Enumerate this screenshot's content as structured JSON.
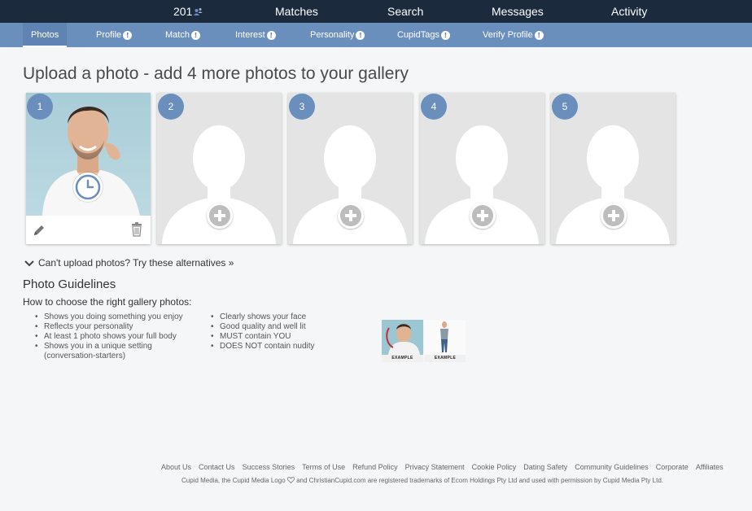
{
  "top_nav": {
    "count": "201",
    "items": [
      "Matches",
      "Search",
      "Messages",
      "Activity"
    ]
  },
  "sub_nav": {
    "tabs": [
      "Photos",
      "Profile",
      "Match",
      "Interest",
      "Personality",
      "CupidTags",
      "Verify Profile"
    ],
    "active": "Photos"
  },
  "main": {
    "title": "Upload a photo - add 4 more photos to your gallery",
    "tiles": [
      {
        "number": "1",
        "state": "pending-approval"
      },
      {
        "number": "2",
        "state": "empty"
      },
      {
        "number": "3",
        "state": "empty"
      },
      {
        "number": "4",
        "state": "empty"
      },
      {
        "number": "5",
        "state": "empty"
      }
    ],
    "alternatives_link": "Can't upload photos? Try these alternatives »"
  },
  "guidelines": {
    "title": "Photo Guidelines",
    "subtitle": "How to choose the right gallery photos:",
    "left_bullets": [
      "Shows you doing something you enjoy",
      "Reflects your personality",
      "At least 1 photo shows your full body",
      "Shows you in a unique setting",
      "(conversation-starters)"
    ],
    "right_bullets": [
      "Clearly shows your face",
      "Good quality and well lit",
      "MUST contain YOU",
      "DOES NOT contain nudity"
    ],
    "example_label": "EXAMPLE"
  },
  "footer": {
    "links": [
      "About Us",
      "Contact Us",
      "Success Stories",
      "Terms of Use",
      "Refund Policy",
      "Privacy Statement",
      "Cookie Policy",
      "Dating Safety",
      "Community Guidelines",
      "Corporate",
      "Affiliates"
    ],
    "legal_pre": "Cupid Media, the Cupid Media Logo",
    "legal_post": "and ChristianCupid.com are registered trademarks of Ecom Holdings Pty Ltd and used with permission by Cupid Media Pty Ltd."
  },
  "colors": {
    "top_nav_bg": "#1b2b3d",
    "sub_nav_bg": "#6a8fbd",
    "tile_number_bg": "#6a8fbd",
    "empty_tile_bg": "#e4e4e4"
  },
  "icons": [
    "matches-count-icon",
    "info-icon",
    "clock-icon",
    "edit-icon",
    "trash-icon",
    "add-photo-icon",
    "chevron-down-icon",
    "heart-icon"
  ]
}
